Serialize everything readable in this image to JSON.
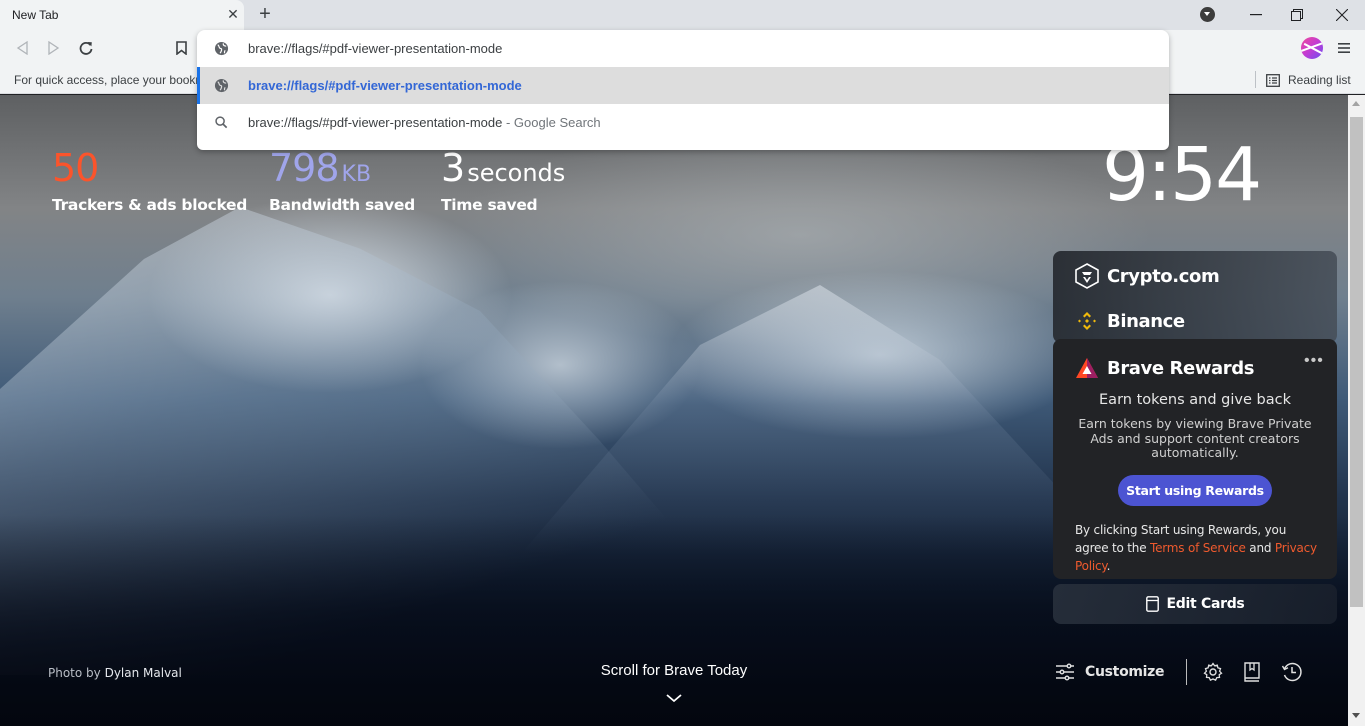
{
  "browser": {
    "tab": {
      "title": "New Tab",
      "close_icon": "close-icon"
    },
    "new_tab_icon": "plus-icon",
    "window_controls": [
      "tab-search",
      "minimize",
      "restore",
      "close"
    ],
    "toolbar": {
      "back_icon": "back-arrow-icon",
      "forward_icon": "forward-arrow-icon",
      "reload_icon": "reload-icon",
      "bookmark_icon": "bookmark-icon",
      "menu_icon": "hamburger-menu-icon"
    },
    "bookmarks_bar": {
      "hint": "For quick access, place your bookmarks here on the bookmarks bar.",
      "reading_list_label": "Reading list"
    }
  },
  "omnibox": {
    "input_value": "brave://flags/#pdf-viewer-presentation-mode",
    "suggestions": [
      {
        "icon": "globe-icon",
        "text": "brave://flags/#pdf-viewer-presentation-mode",
        "selected": true
      },
      {
        "icon": "search-icon",
        "text": "brave://flags/#pdf-viewer-presentation-mode",
        "suffix": " - Google Search",
        "selected": false
      }
    ]
  },
  "ntp": {
    "stats": [
      {
        "value": "50",
        "unit": "",
        "label": "Trackers & ads blocked",
        "color": "#fb542b"
      },
      {
        "value": "798",
        "unit": "KB",
        "label": "Bandwidth saved",
        "color": "#a0a5eb"
      },
      {
        "value": "3",
        "unit": "seconds",
        "label": "Time saved",
        "color": "#ffffff"
      }
    ],
    "clock": "9:54",
    "cards": {
      "crypto_com": "Crypto.com",
      "binance": "Binance",
      "rewards": {
        "title": "Brave Rewards",
        "more_icon": "more-dots-icon",
        "heading": "Earn tokens and give back",
        "body": "Earn tokens by viewing Brave Private Ads and support content creators automatically.",
        "button": "Start using Rewards",
        "legal_prefix": "By clicking Start using Rewards, you agree to the ",
        "terms_link": "Terms of Service",
        "legal_and": " and ",
        "privacy_link": "Privacy Policy",
        "legal_suffix": "."
      },
      "edit_cards": "Edit Cards"
    },
    "photo_credit": {
      "prefix": "Photo by ",
      "author": "Dylan Malval"
    },
    "scroll_today": "Scroll for Brave Today",
    "bottom_tools": {
      "customize": "Customize",
      "icons": [
        "settings-gear-icon",
        "bookmarks-book-icon",
        "history-clock-icon"
      ]
    },
    "accent_colors": {
      "brave_orange": "#fb542b",
      "rewards_button": "#4c54d2",
      "omnibox_selected": "#3367d6"
    }
  }
}
